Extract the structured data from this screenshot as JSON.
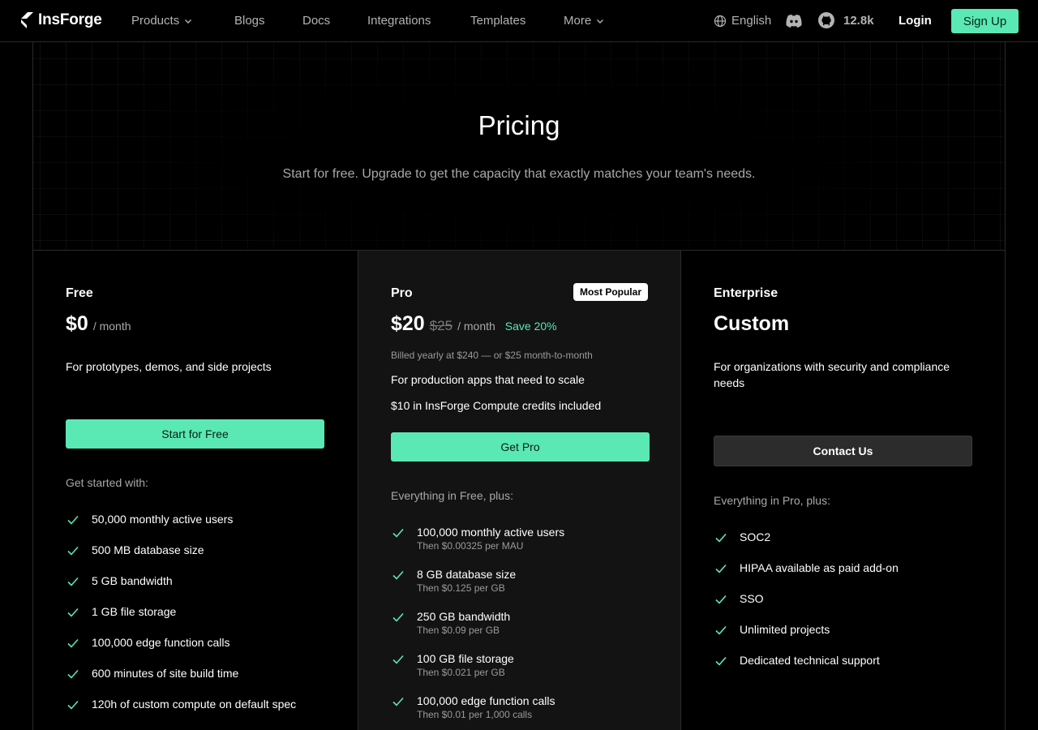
{
  "nav": {
    "brand": "InsForge",
    "links": [
      {
        "label": "Products",
        "dropdown": true
      },
      {
        "label": "Blogs",
        "dropdown": false
      },
      {
        "label": "Docs",
        "dropdown": false
      },
      {
        "label": "Integrations",
        "dropdown": false
      },
      {
        "label": "Templates",
        "dropdown": false
      },
      {
        "label": "More",
        "dropdown": true
      }
    ],
    "language": "English",
    "github_stars": "12.8k",
    "login": "Login",
    "signup": "Sign Up",
    "icons": [
      "globe-icon",
      "discord-icon",
      "github-icon",
      "chevron-down-icon",
      "check-icon"
    ]
  },
  "hero": {
    "title": "Pricing",
    "subtitle": "Start for free. Upgrade to get the capacity that exactly matches your team's needs."
  },
  "colors": {
    "accent": "#5ae8b4",
    "background": "#000000",
    "pro_card": "#131313"
  },
  "plans": {
    "free": {
      "name": "Free",
      "price": "$0",
      "period": "/ month",
      "description": "For prototypes, demos, and side projects",
      "cta": "Start for Free",
      "list_heading": "Get started with:",
      "features": [
        {
          "text": "50,000 monthly active users"
        },
        {
          "text": "500 MB database size"
        },
        {
          "text": "5 GB bandwidth"
        },
        {
          "text": "1 GB file storage"
        },
        {
          "text": "100,000 edge function calls"
        },
        {
          "text": "600 minutes of site build time"
        },
        {
          "text": "120h of custom compute on default spec"
        }
      ]
    },
    "pro": {
      "name": "Pro",
      "badge": "Most Popular",
      "price": "$20",
      "old_price": "$25",
      "period": "/ month",
      "save": "Save 20%",
      "billed": "Billed yearly at $240 — or $25 month-to-month",
      "description": "For production apps that need to scale",
      "credits": "$10 in InsForge Compute credits included",
      "cta": "Get Pro",
      "list_heading": "Everything in Free, plus:",
      "features": [
        {
          "text": "100,000 monthly active users",
          "sub": "Then $0.00325 per MAU"
        },
        {
          "text": "8 GB database size",
          "sub": "Then $0.125 per GB"
        },
        {
          "text": "250 GB bandwidth",
          "sub": "Then $0.09 per GB"
        },
        {
          "text": "100 GB file storage",
          "sub": "Then $0.021 per GB"
        },
        {
          "text": "100,000 edge function calls",
          "sub": "Then $0.01 per 1,000 calls"
        }
      ]
    },
    "enterprise": {
      "name": "Enterprise",
      "price": "Custom",
      "description": "For organizations with security and compliance needs",
      "cta": "Contact Us",
      "list_heading": "Everything in Pro, plus:",
      "features": [
        {
          "text": "SOC2"
        },
        {
          "text": "HIPAA available as paid add-on"
        },
        {
          "text": "SSO"
        },
        {
          "text": "Unlimited projects"
        },
        {
          "text": "Dedicated technical support"
        }
      ]
    }
  }
}
